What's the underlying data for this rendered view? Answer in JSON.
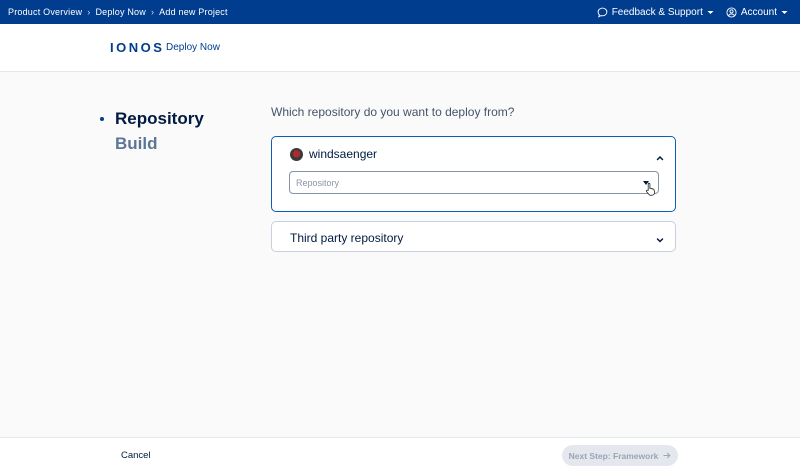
{
  "topbar": {
    "breadcrumb": [
      "Product Overview",
      "Deploy Now",
      "Add new Project"
    ],
    "feedback_label": "Feedback & Support",
    "account_label": "Account"
  },
  "header": {
    "logo": "IONOS",
    "product": "Deploy Now"
  },
  "steps": [
    {
      "label": "Repository",
      "active": true
    },
    {
      "label": "Build",
      "active": false
    }
  ],
  "question": "Which repository do you want to deploy from?",
  "account_panel": {
    "username": "windsaenger",
    "repository_placeholder": "Repository"
  },
  "third_party_panel": {
    "label": "Third party repository"
  },
  "footer": {
    "cancel_label": "Cancel",
    "next_label": "Next Step: Framework"
  },
  "colors": {
    "topbar": "#003d8f",
    "accent": "#0b5fb6",
    "text_dark": "#001b41",
    "button_disabled_bg": "#e4e8ee"
  }
}
